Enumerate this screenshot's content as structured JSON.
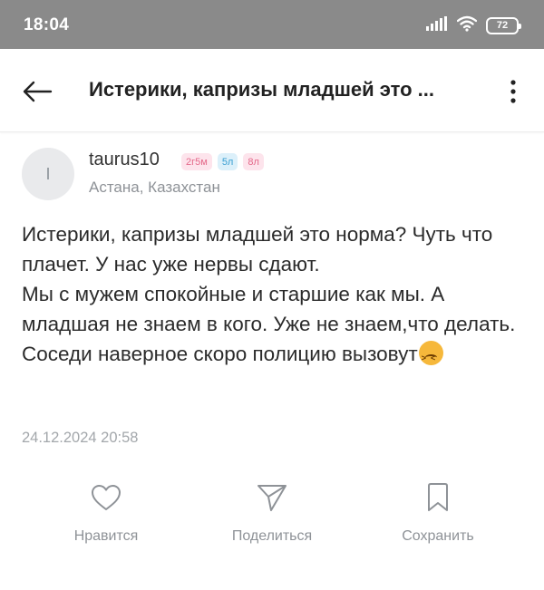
{
  "status_bar": {
    "time": "18:04",
    "battery": "72"
  },
  "app_bar": {
    "title": "Истерики, капризы младшей это ..."
  },
  "author": {
    "avatar_initial": "I",
    "name": "taurus10",
    "badges": [
      {
        "text": "2г5м",
        "color": "pink"
      },
      {
        "text": "5л",
        "color": "blue"
      },
      {
        "text": "8л",
        "color": "pink"
      }
    ],
    "city": "Астана, Казахстан"
  },
  "post": {
    "text": "Истерики, капризы младшей это норма? Чуть что плачет. У нас уже нервы сдают.\nМы с мужем спокойные и старшие как мы. А младшая не знаем в кого. Уже не знаем,что делать. Соседи наверное скоро полицию вызовут",
    "emoji": "confounded-face",
    "date": "24.12.2024 20:58"
  },
  "actions": {
    "like_label": "Нравится",
    "share_label": "Поделиться",
    "save_label": "Сохранить"
  },
  "colors": {
    "status_bar": "#8a8a8a",
    "text": "#2b2b2b",
    "muted": "#8e9297",
    "badge_pink": "#e46a8b",
    "badge_blue": "#3a9fd2"
  }
}
